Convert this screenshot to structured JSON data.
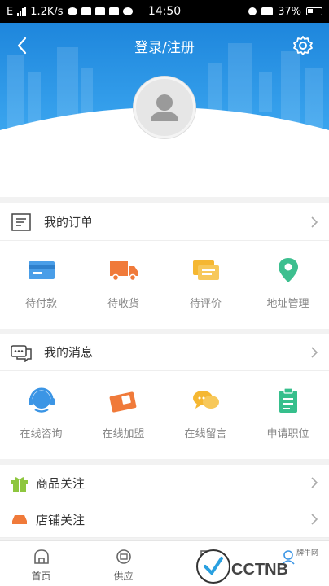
{
  "status_bar": {
    "network": "E",
    "speed": "1.2K/s",
    "time": "14:50",
    "battery": "37%"
  },
  "header": {
    "title": "登录/注册",
    "back_icon": "chevron-left-icon",
    "settings_icon": "gear-icon"
  },
  "orders": {
    "title": "我的订单",
    "items": [
      {
        "label": "待付款",
        "icon": "card-icon",
        "color": "#4a9ee8"
      },
      {
        "label": "待收货",
        "icon": "truck-icon",
        "color": "#f07a3a"
      },
      {
        "label": "待评价",
        "icon": "comment-list-icon",
        "color": "#f5b731"
      },
      {
        "label": "地址管理",
        "icon": "location-pin-icon",
        "color": "#3dbf8f"
      }
    ]
  },
  "messages": {
    "title": "我的消息",
    "items": [
      {
        "label": "在线咨询",
        "icon": "headset-icon",
        "color": "#3b95e5"
      },
      {
        "label": "在线加盟",
        "icon": "wallet-icon",
        "color": "#f07a3a"
      },
      {
        "label": "在线留言",
        "icon": "chat-bubbles-icon",
        "color": "#f5b731"
      },
      {
        "label": "申请职位",
        "icon": "clipboard-icon",
        "color": "#36bf8c"
      }
    ]
  },
  "follows": [
    {
      "label": "商品关注",
      "icon": "gift-icon",
      "color": "#8ec63f"
    },
    {
      "label": "店铺关注",
      "icon": "shop-icon",
      "color": "#f07a3a"
    }
  ],
  "tabbar": [
    {
      "label": "首页",
      "icon": "home-icon"
    },
    {
      "label": "供应",
      "icon": "supply-icon"
    },
    {
      "label": "",
      "icon": "tab-icon"
    },
    {
      "label": "",
      "icon": "profile-icon"
    }
  ],
  "watermark": {
    "text": "CCTNB",
    "sub": "牌牛网"
  }
}
